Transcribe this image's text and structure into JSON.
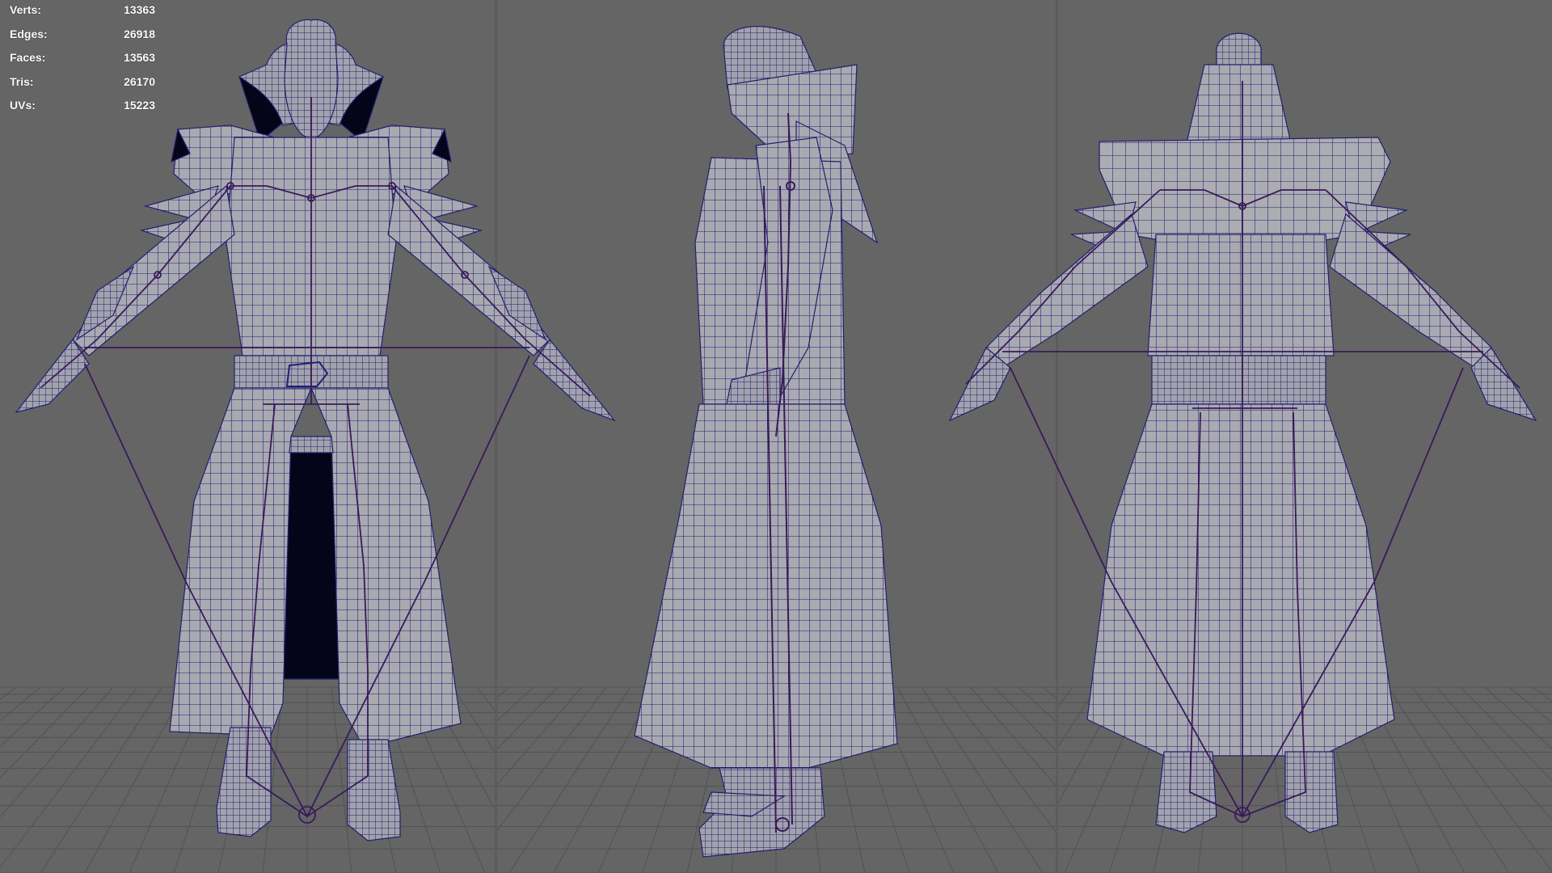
{
  "hud": {
    "stats": [
      {
        "label": "Verts:",
        "value": "13363"
      },
      {
        "label": "Edges:",
        "value": "26918"
      },
      {
        "label": "Faces:",
        "value": "13563"
      },
      {
        "label": "Tris:",
        "value": "26170"
      },
      {
        "label": "UVs:",
        "value": "15223"
      }
    ]
  },
  "colors": {
    "background": "#656565",
    "grid_line": "#4d4d4d",
    "mesh_fill": "#a9a9b1",
    "wireframe": "#21206e",
    "skeleton": "#3a1a5a",
    "hud_text": "#ffffff",
    "interior_dark": "#050510"
  },
  "views": [
    {
      "name": "front-view"
    },
    {
      "name": "side-view"
    },
    {
      "name": "back-view"
    }
  ]
}
